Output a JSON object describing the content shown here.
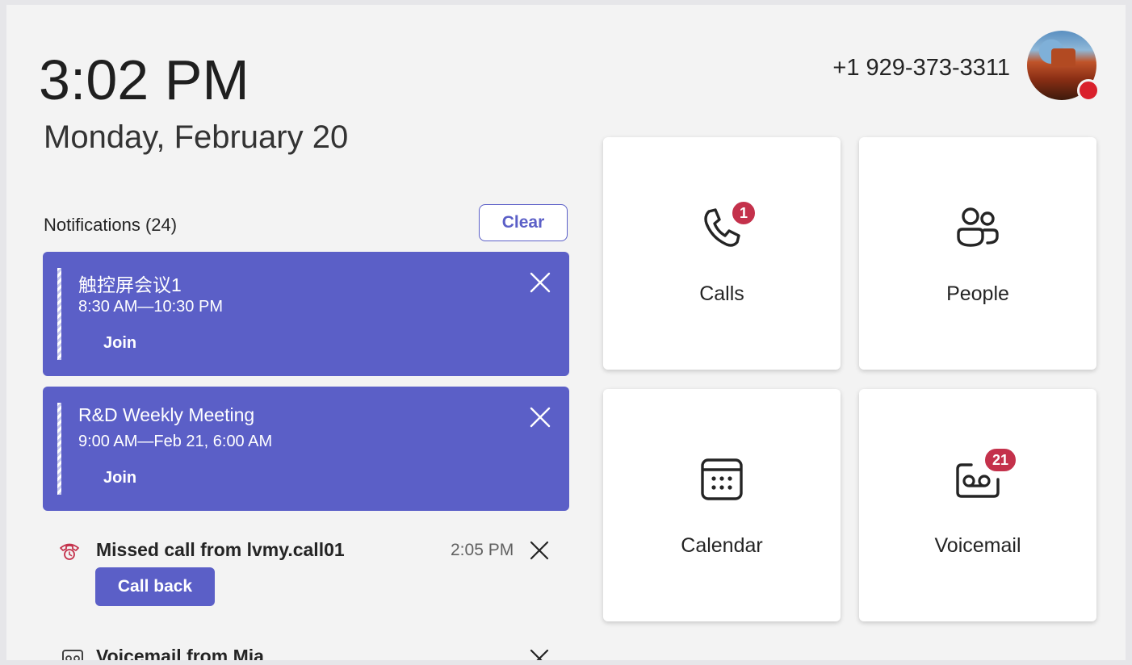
{
  "clock": {
    "time": "3:02 PM",
    "date": "Monday, February 20"
  },
  "account": {
    "phone": "+1 929-373-3311",
    "status_color": "#d9202b"
  },
  "notifications": {
    "header": "Notifications (24)",
    "clear_label": "Clear",
    "meetings": [
      {
        "title": "触控屏会议1",
        "time": "8:30 AM—10:30 PM",
        "join_label": "Join"
      },
      {
        "title": "R&D Weekly Meeting",
        "time": "9:00 AM—Feb 21, 6:00 AM",
        "join_label": "Join"
      }
    ],
    "missed_call": {
      "title": "Missed call from lvmy.call01",
      "time": "2:05 PM",
      "action_label": "Call back"
    },
    "voicemail": {
      "title": "Voicemail from Mia"
    }
  },
  "tiles": [
    {
      "label": "Calls",
      "icon": "phone-icon",
      "badge": "1"
    },
    {
      "label": "People",
      "icon": "people-icon"
    },
    {
      "label": "Calendar",
      "icon": "calendar-icon"
    },
    {
      "label": "Voicemail",
      "icon": "voicemail-icon",
      "badge": "21"
    }
  ],
  "colors": {
    "accent": "#5b5fc7",
    "badge": "#c4314b",
    "missed": "#c4314b"
  }
}
